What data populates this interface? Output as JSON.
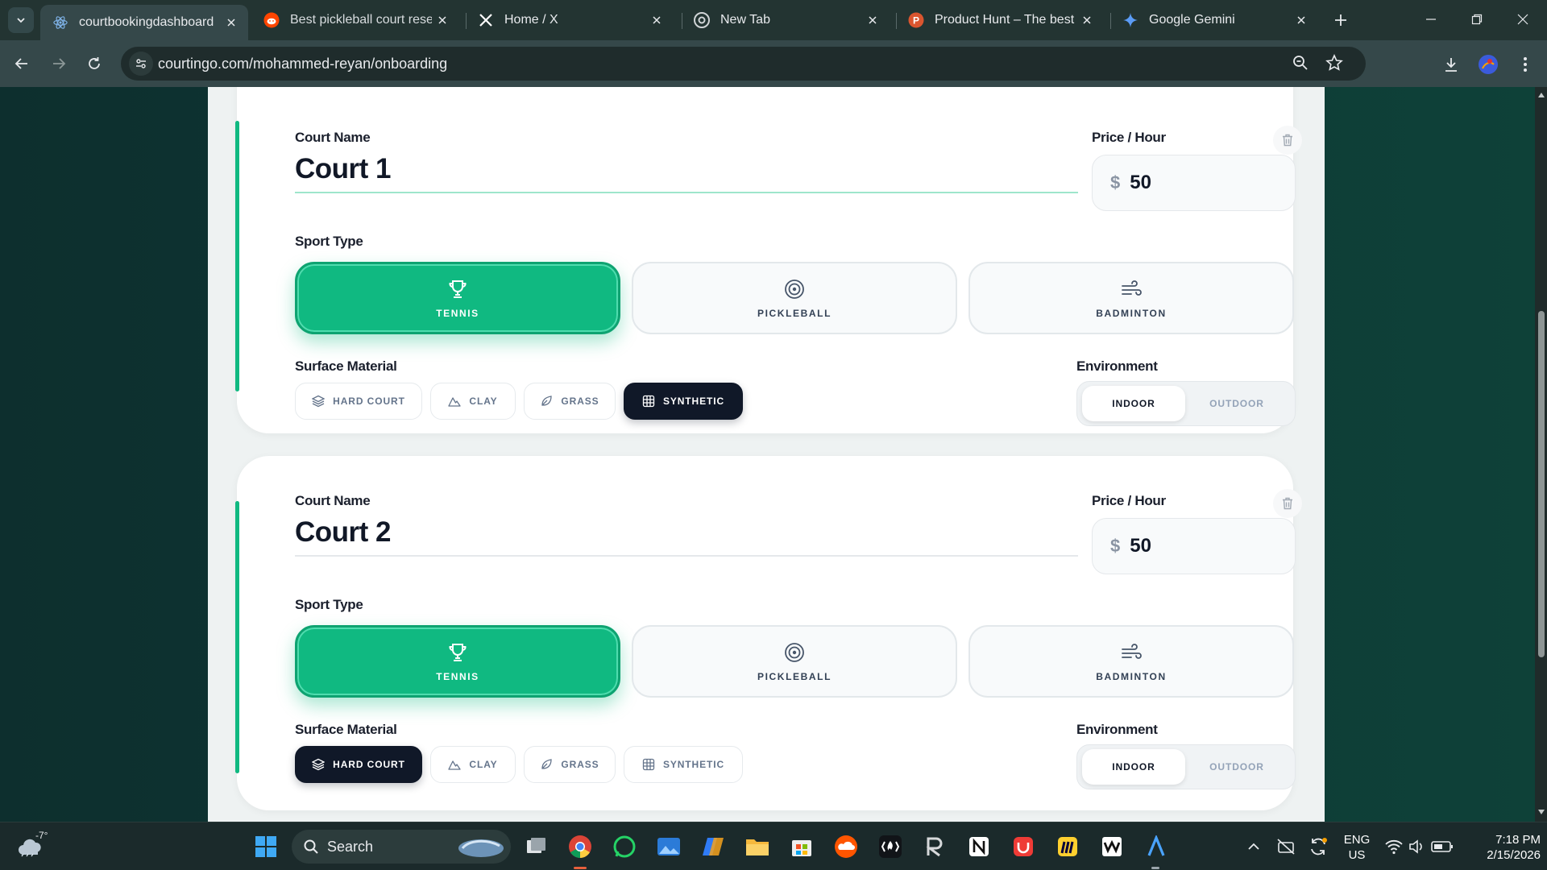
{
  "browser": {
    "tabs": [
      {
        "title": "courtbookingdashboard",
        "icon": "react-icon",
        "active": true
      },
      {
        "title": "Best pickleball court reserv",
        "icon": "reddit-icon",
        "active": false
      },
      {
        "title": "Home / X",
        "icon": "x-logo-icon",
        "active": false
      },
      {
        "title": "New Tab",
        "icon": "chrome-icon",
        "active": false
      },
      {
        "title": "Product Hunt – The best n",
        "icon": "product-hunt-icon",
        "active": false
      },
      {
        "title": "Google Gemini",
        "icon": "gemini-icon",
        "active": false
      }
    ],
    "url": "courtingo.com/mohammed-reyan/onboarding"
  },
  "courts": [
    {
      "name_label": "Court Name",
      "name": "Court 1",
      "price_label": "Price / Hour",
      "currency": "$",
      "price": "50",
      "sport_label": "Sport Type",
      "sports": [
        {
          "label": "TENNIS",
          "icon": "trophy-icon",
          "selected": true
        },
        {
          "label": "PICKLEBALL",
          "icon": "target-icon",
          "selected": false
        },
        {
          "label": "BADMINTON",
          "icon": "wind-icon",
          "selected": false
        }
      ],
      "surface_label": "Surface Material",
      "surfaces": [
        {
          "label": "HARD COURT",
          "icon": "layers-icon",
          "selected": false
        },
        {
          "label": "CLAY",
          "icon": "mountain-icon",
          "selected": false
        },
        {
          "label": "GRASS",
          "icon": "leaf-icon",
          "selected": false
        },
        {
          "label": "SYNTHETIC",
          "icon": "grid-icon",
          "selected": true
        }
      ],
      "environment_label": "Environment",
      "environments": [
        {
          "label": "INDOOR",
          "selected": true
        },
        {
          "label": "OUTDOOR",
          "selected": false
        }
      ]
    },
    {
      "name_label": "Court Name",
      "name": "Court 2",
      "price_label": "Price / Hour",
      "currency": "$",
      "price": "50",
      "sport_label": "Sport Type",
      "sports": [
        {
          "label": "TENNIS",
          "icon": "trophy-icon",
          "selected": true
        },
        {
          "label": "PICKLEBALL",
          "icon": "target-icon",
          "selected": false
        },
        {
          "label": "BADMINTON",
          "icon": "wind-icon",
          "selected": false
        }
      ],
      "surface_label": "Surface Material",
      "surfaces": [
        {
          "label": "HARD COURT",
          "icon": "layers-icon",
          "selected": true
        },
        {
          "label": "CLAY",
          "icon": "mountain-icon",
          "selected": false
        },
        {
          "label": "GRASS",
          "icon": "leaf-icon",
          "selected": false
        },
        {
          "label": "SYNTHETIC",
          "icon": "grid-icon",
          "selected": false
        }
      ],
      "environment_label": "Environment",
      "environments": [
        {
          "label": "INDOOR",
          "selected": true
        },
        {
          "label": "OUTDOOR",
          "selected": false
        }
      ]
    }
  ],
  "colors": {
    "accent": "#10b981",
    "dark_selected": "#101828",
    "page_background": "#0f3a37"
  },
  "taskbar": {
    "weather_temp": "-7°",
    "search_placeholder": "Search",
    "pinned_apps": [
      "file-explorer-icon",
      "chrome-icon",
      "whatsapp-icon",
      "photos-icon",
      "copilot-icon",
      "folder-icon",
      "store-icon",
      "soundcloud-icon",
      "fire-app-icon",
      "r-app-icon",
      "notion-icon",
      "app-red-icon",
      "miro-icon",
      "w-app-icon",
      "arc-app-icon"
    ],
    "language": "ENG",
    "region": "US",
    "time": "7:18 PM",
    "date": "2/15/2026"
  }
}
